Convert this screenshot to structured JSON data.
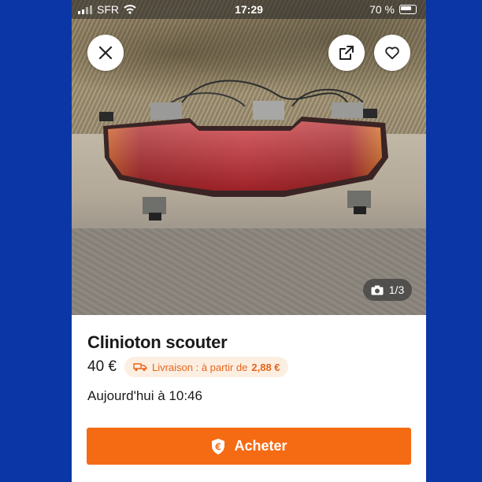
{
  "status_bar": {
    "carrier": "SFR",
    "time": "17:29",
    "battery": "70 %"
  },
  "gallery": {
    "counter": "1/3",
    "close_icon": "close-icon",
    "share_icon": "share-external-icon",
    "favorite_icon": "heart-icon",
    "camera_icon": "camera-icon"
  },
  "listing": {
    "title": "Clinioton scouter",
    "price": "40 €",
    "delivery_prefix": "Livraison : à partir de",
    "delivery_price": "2,88 €",
    "posted": "Aujourd'hui à 10:46"
  },
  "actions": {
    "buy_label": "Acheter",
    "buy_icon": "shield-euro-icon"
  },
  "colors": {
    "page_background": "#0a36a6",
    "accent": "#f56b14",
    "delivery_badge_bg": "#fdeee2",
    "delivery_badge_text": "#e5661b"
  }
}
